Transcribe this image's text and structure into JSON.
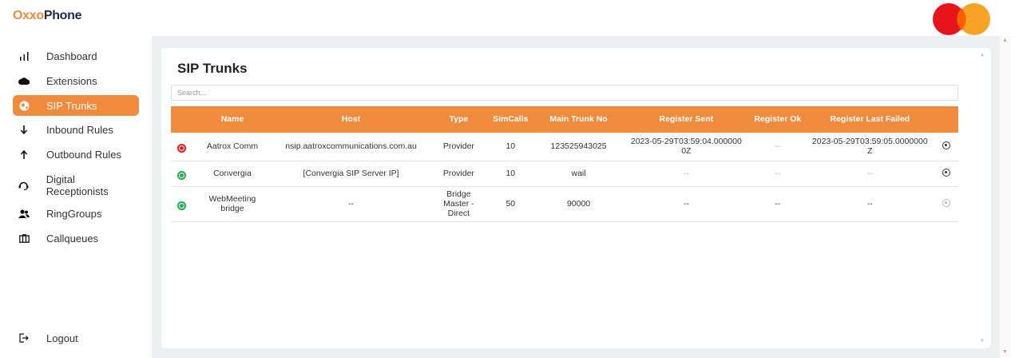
{
  "brand": {
    "part1": "Oxxo",
    "part2": "Phone"
  },
  "sidebar": {
    "items": [
      {
        "label": "Dashboard",
        "icon": "bar-chart-icon"
      },
      {
        "label": "Extensions",
        "icon": "cloud-icon"
      },
      {
        "label": "SIP Trunks",
        "icon": "globe-icon",
        "active": true
      },
      {
        "label": "Inbound Rules",
        "icon": "arrow-down-icon"
      },
      {
        "label": "Outbound Rules",
        "icon": "arrow-up-icon"
      },
      {
        "label": "Digital Receptionists",
        "icon": "receptionist-icon"
      },
      {
        "label": "RingGroups",
        "icon": "users-icon"
      },
      {
        "label": "Callqueues",
        "icon": "queue-icon"
      }
    ],
    "logout": "Logout"
  },
  "page": {
    "title": "SIP Trunks"
  },
  "search": {
    "placeholder": "Search..."
  },
  "table": {
    "headers": [
      "",
      "Name",
      "Host",
      "Type",
      "SimCalls",
      "Main Trunk No",
      "Register Sent",
      "Register Ok",
      "Register Last Failed",
      ""
    ],
    "rows": [
      {
        "status": "red",
        "name": "Aatrox Comm",
        "host": "nsip.aatroxcommunications.com.au",
        "type": "Provider",
        "simcalls": "10",
        "main_trunk_no": "123525943025",
        "register_sent": "2023-05-29T03:59:04.0000000Z",
        "register_ok": "--",
        "register_last_failed": "2023-05-29T03:59:05.0000000Z"
      },
      {
        "status": "green",
        "name": "Convergia",
        "host": "[Convergia SIP Server IP]",
        "type": "Provider",
        "simcalls": "10",
        "main_trunk_no": "wail",
        "register_sent": "--",
        "register_ok": "--",
        "register_last_failed": "--"
      },
      {
        "status": "green",
        "name": "WebMeeting bridge",
        "host": "--",
        "type": "Bridge Master - Direct",
        "simcalls": "50",
        "main_trunk_no": "90000",
        "register_sent": "--",
        "register_ok": "--",
        "register_last_failed": "--"
      }
    ]
  },
  "colors": {
    "accent": "#f08a3c",
    "status_red": "#e02020",
    "status_green": "#23b04a",
    "content_bg": "#eeeff1"
  }
}
